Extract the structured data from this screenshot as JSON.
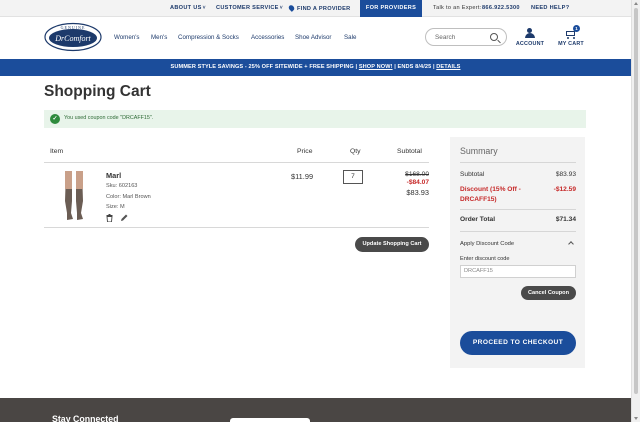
{
  "utility": {
    "about_us": "ABOUT US",
    "customer_service": "CUSTOMER SERVICE",
    "find_provider": "FIND A PROVIDER",
    "for_providers": "FOR PROVIDERS",
    "talk_to_expert": "Talk to an Expert:",
    "phone": "866.922.5300",
    "need_help": "NEED HELP?",
    "chevron": "˅"
  },
  "header": {
    "logo_top_text": "GENUINE",
    "logo_text": "DrComfort",
    "nav": [
      "Women's",
      "Men's",
      "Compression & Socks",
      "Accessories",
      "Shoe Advisor",
      "Sale"
    ],
    "search_placeholder": "Search",
    "account_label": "ACCOUNT",
    "cart_label": "MY CART",
    "cart_count": "1"
  },
  "promo": {
    "text": "SUMMER STYLE SAVINGS - 25% OFF SITEWIDE + FREE SHIPPING",
    "sep1": " | ",
    "shop_now": "SHOP NOW!",
    "sep2": " | ENDS 8/4/25 | ",
    "details": "DETAILS"
  },
  "page": {
    "title": "Shopping Cart",
    "coupon_message": "You used coupon code \"DRCAFF15\".",
    "check_glyph": "✓"
  },
  "cart": {
    "headers": {
      "item": "Item",
      "price": "Price",
      "qty": "Qty",
      "subtotal": "Subtotal"
    },
    "item": {
      "name": "Marl",
      "sku": "Sku: 602163",
      "color": "Color: Marl Brown",
      "size": "Size: M",
      "price": "$11.99",
      "qty": "7",
      "subtotal_original": "$168.00",
      "subtotal_discount": "-$84.07",
      "subtotal_final": "$83.93"
    },
    "update_button": "Update Shopping Cart"
  },
  "summary": {
    "heading": "Summary",
    "subtotal_label": "Subtotal",
    "subtotal_value": "$83.93",
    "discount_label_line1": "Discount (15% Off -",
    "discount_label_line2": "DRCAFF15)",
    "discount_value": "-$12.59",
    "order_total_label": "Order Total",
    "order_total_value": "$71.34",
    "apply_discount_label": "Apply Discount Code",
    "enter_discount_label": "Enter discount code",
    "discount_code_value": "DRCAFF15",
    "cancel_coupon": "Cancel Coupon",
    "checkout": "PROCEED TO CHECKOUT"
  },
  "footer": {
    "heading": "Stay Connected"
  },
  "colors": {
    "brand_blue": "#1b4d9b",
    "discount_red": "#c62828",
    "success_green": "#2e8b3d",
    "dark_button": "#4a4a4a"
  }
}
